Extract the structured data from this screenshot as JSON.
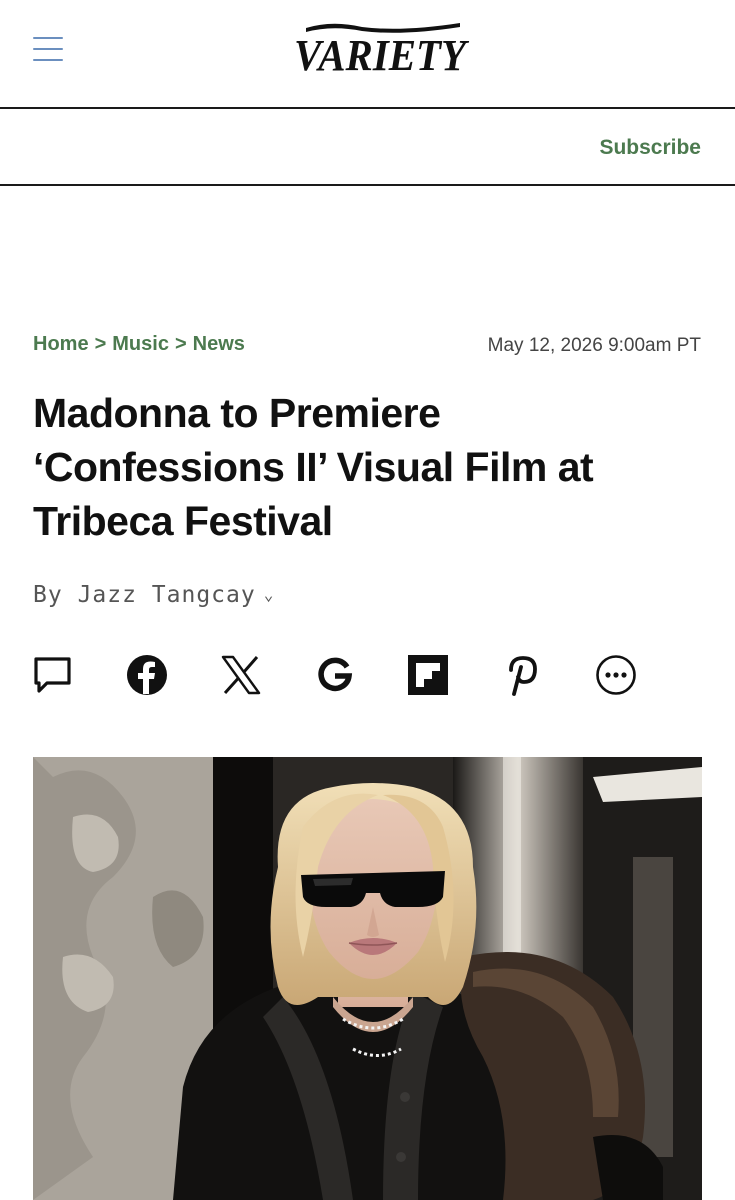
{
  "header": {
    "logo_text": "VARIETY",
    "subscribe_label": "Subscribe"
  },
  "breadcrumb": {
    "items": [
      "Home",
      "Music",
      "News"
    ],
    "separator": ">"
  },
  "article": {
    "date": "May 12, 2026 9:00am PT",
    "headline": "Madonna to Premiere ‘Confessions II’ Visual Film at Tribeca Festival",
    "byline_prefix": "By",
    "author": "Jazz Tangcay"
  },
  "share_icons": [
    "comment-icon",
    "facebook-icon",
    "x-icon",
    "google-icon",
    "flipboard-icon",
    "pinterest-icon",
    "more-icon"
  ],
  "colors": {
    "accent_green": "#4c7a4f",
    "menu_blue": "#6b8fbf",
    "text": "#111111"
  }
}
